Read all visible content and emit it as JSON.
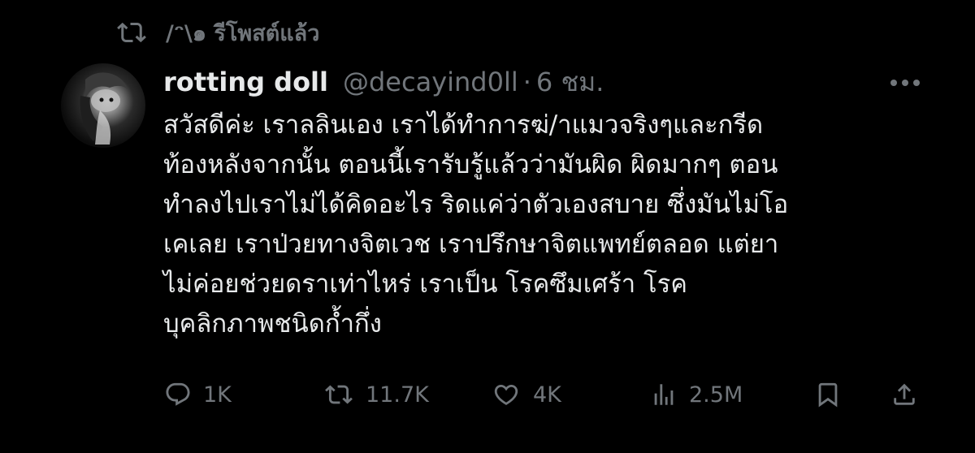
{
  "repost_banner": {
    "text": "/ᵔ\\๑ รีโพสต์แล้ว"
  },
  "tweet": {
    "display_name": "rotting doll",
    "handle": "@decayind0ll",
    "separator": "·",
    "time": "6 ชม.",
    "lines": [
      "สวัสดีค่ะ เราลลินเอง เราได้ทำการฆ่/าแมวจริงๆและกรีด",
      "ท้องหลังจากนั้น ตอนนี้เรารับรู้แล้วว่ามันผิด ผิดมากๆ ตอน",
      "ทำลงไปเราไม่ได้คิดอะไร ริดแค่ว่าตัวเองสบาย ซึ่งมันไม่โอ",
      "เคเลย เราป่วยทางจิตเวช เราปรึกษาจิตแพทย์ตลอด แต่ยา",
      "ไม่ค่อยช่วยดราเท่าไหร่ เราเป็น โรคซึมเศร้า โรค",
      "บุคลิกภาพชนิดก้ำกึ่ง"
    ]
  },
  "actions": {
    "replies": "1K",
    "reposts": "11.7K",
    "likes": "4K",
    "views": "2.5M"
  },
  "colors": {
    "background": "#000000",
    "primary_text": "#e7e9ea",
    "secondary_text": "#71767b"
  },
  "icons": {
    "repost": "repost-icon",
    "more": "more-icon",
    "reply": "reply-icon",
    "like": "heart-icon",
    "views": "views-icon",
    "bookmark": "bookmark-icon",
    "share": "share-icon"
  }
}
